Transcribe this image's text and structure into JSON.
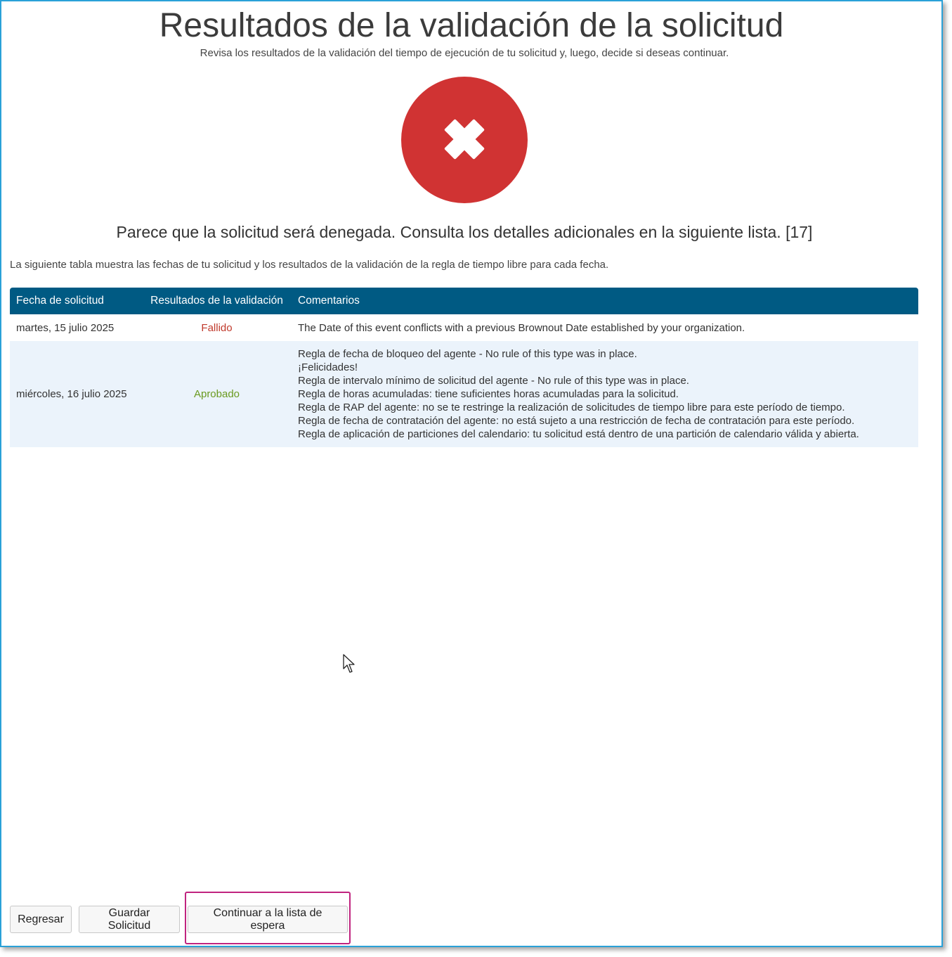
{
  "header": {
    "title": "Resultados de la validación de la solicitud",
    "subtitle": "Revisa los resultados de la validación del tiempo de ejecución de tu solicitud y, luego, decide si deseas continuar."
  },
  "status": {
    "icon": "error-x-icon",
    "color": "#d03333",
    "message": "Parece que la solicitud será denegada. Consulta los detalles adicionales en la siguiente lista. [17]"
  },
  "intro": "La siguiente tabla muestra las fechas de tu solicitud y los resultados de la validación de la regla de tiempo libre para cada fecha.",
  "table": {
    "headers": [
      "Fecha de solicitud",
      "Resultados de la validación",
      "Comentarios"
    ],
    "header_color": "#005a83",
    "rows": [
      {
        "date": "martes, 15 julio 2025",
        "result": "Fallido",
        "comments": [
          "The Date of this event conflicts with a previous Brownout Date established by your organization."
        ]
      },
      {
        "date": "miércoles, 16 julio 2025",
        "result": "Aprobado",
        "comments": [
          "Regla de fecha de bloqueo del agente - No rule of this type was in place.",
          "¡Felicidades!",
          "Regla de intervalo mínimo de solicitud del agente - No rule of this type was in place.",
          "Regla de horas acumuladas: tiene suficientes horas acumuladas para la solicitud.",
          "Regla de RAP del agente: no se te restringe la realización de solicitudes de tiempo libre para este período de tiempo.",
          "Regla de fecha de contratación del agente: no está sujeto a una restricción de fecha de contratación para este período.",
          "Regla de aplicación de particiones del calendario: tu solicitud está dentro de una partición de calendario válida y abierta."
        ]
      }
    ]
  },
  "buttons": {
    "back": "Regresar",
    "save": "Guardar Solicitud",
    "continue": "Continuar a la lista de espera"
  }
}
